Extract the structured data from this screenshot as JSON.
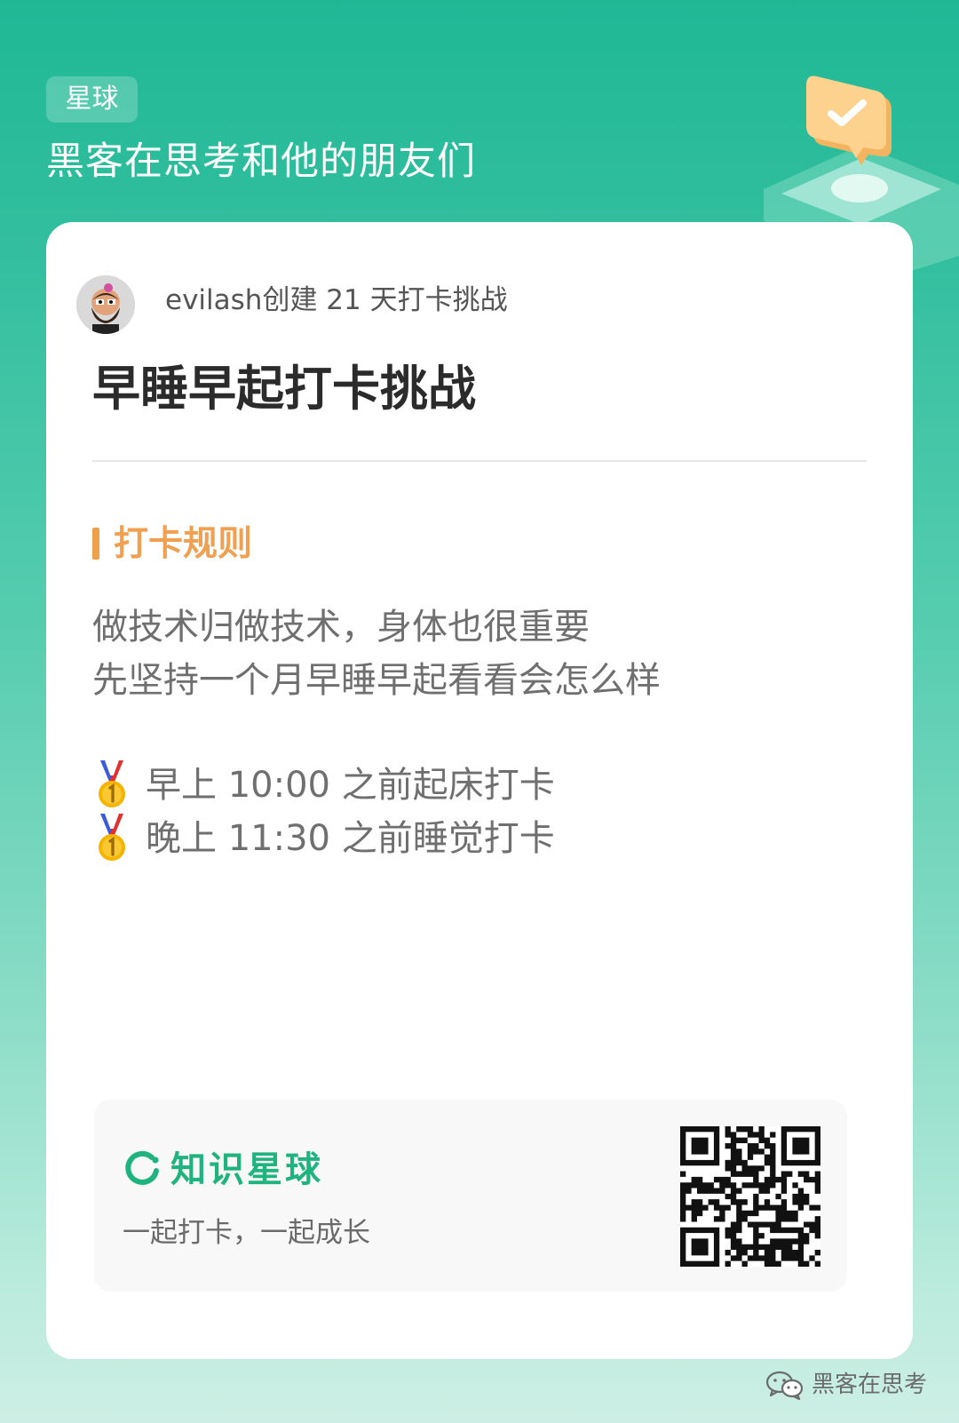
{
  "header": {
    "tag_label": "星球",
    "planet_name": "黑客在思考和他的朋友们"
  },
  "card": {
    "creator_text": "evilash创建 21 天打卡挑战",
    "challenge_title": "早睡早起打卡挑战",
    "rules_heading": "打卡规则",
    "rules_lines": [
      "做技术归做技术，身体也很重要",
      "先坚持一个月早睡早起看看会怎么样"
    ],
    "rule_items": [
      {
        "icon": "first-place-medal-icon",
        "text": "早上 10:00 之前起床打卡"
      },
      {
        "icon": "first-place-medal-icon",
        "text": "晚上 11:30 之前睡觉打卡"
      }
    ]
  },
  "footer": {
    "brand_name": "知识星球",
    "slogan": "一起打卡，一起成长",
    "qr_icon": "qr-code"
  },
  "watermark": {
    "icon": "wechat-icon",
    "text": "黑客在思考"
  },
  "colors": {
    "background_top": "#1fb895",
    "background_bottom": "#cdeee4",
    "accent_orange": "#f0a050",
    "brand_green": "#1fb37f"
  }
}
